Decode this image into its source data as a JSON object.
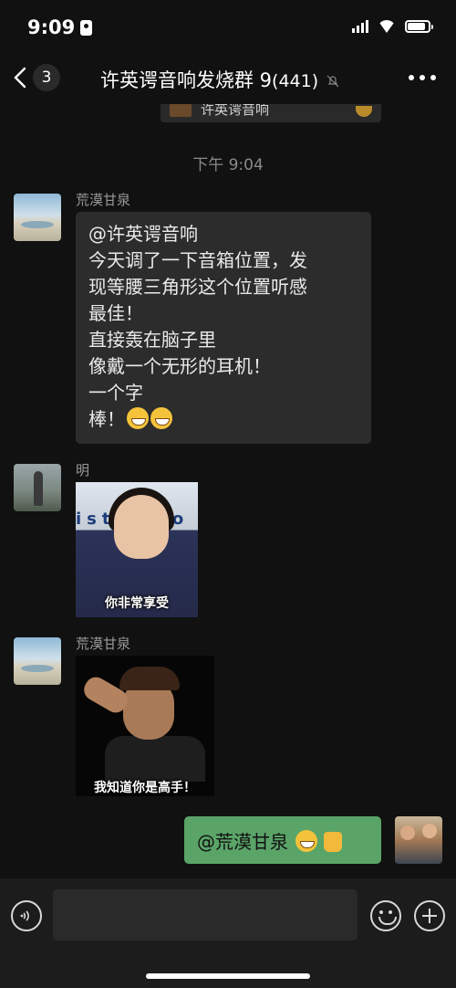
{
  "status_bar": {
    "time": "9:09",
    "battery_level": 0.85
  },
  "nav": {
    "back_count": "3",
    "title": "许英谔音响发烧群 9",
    "member_count": "(441)"
  },
  "quoted_banner": {
    "text": "许英谔音响"
  },
  "timestamp": "下午 9:04",
  "messages": [
    {
      "sender": "荒漠甘泉",
      "lines": [
        "@许英谔音响",
        "今天调了一下音箱位置，发",
        "现等腰三角形这个位置听感",
        "最佳！",
        "直接轰在脑子里",
        "像戴一个无形的耳机！",
        "一个字",
        "棒！"
      ]
    },
    {
      "sender": "明",
      "sticker_caption": "你非常享受",
      "sticker_bg_text": "istry Fo"
    },
    {
      "sender": "荒漠甘泉",
      "sticker_caption": "我知道你是高手！"
    },
    {
      "text": "@荒漠甘泉"
    }
  ],
  "icons": {
    "back": "chevron-left-icon",
    "mute": "bell-off-icon",
    "more": "more-icon",
    "voice": "voice-icon",
    "emoji": "emoji-icon",
    "plus": "plus-icon"
  },
  "colors": {
    "background": "#111111",
    "bubble_other": "#2c2c2c",
    "bubble_self": "#5aa468"
  }
}
